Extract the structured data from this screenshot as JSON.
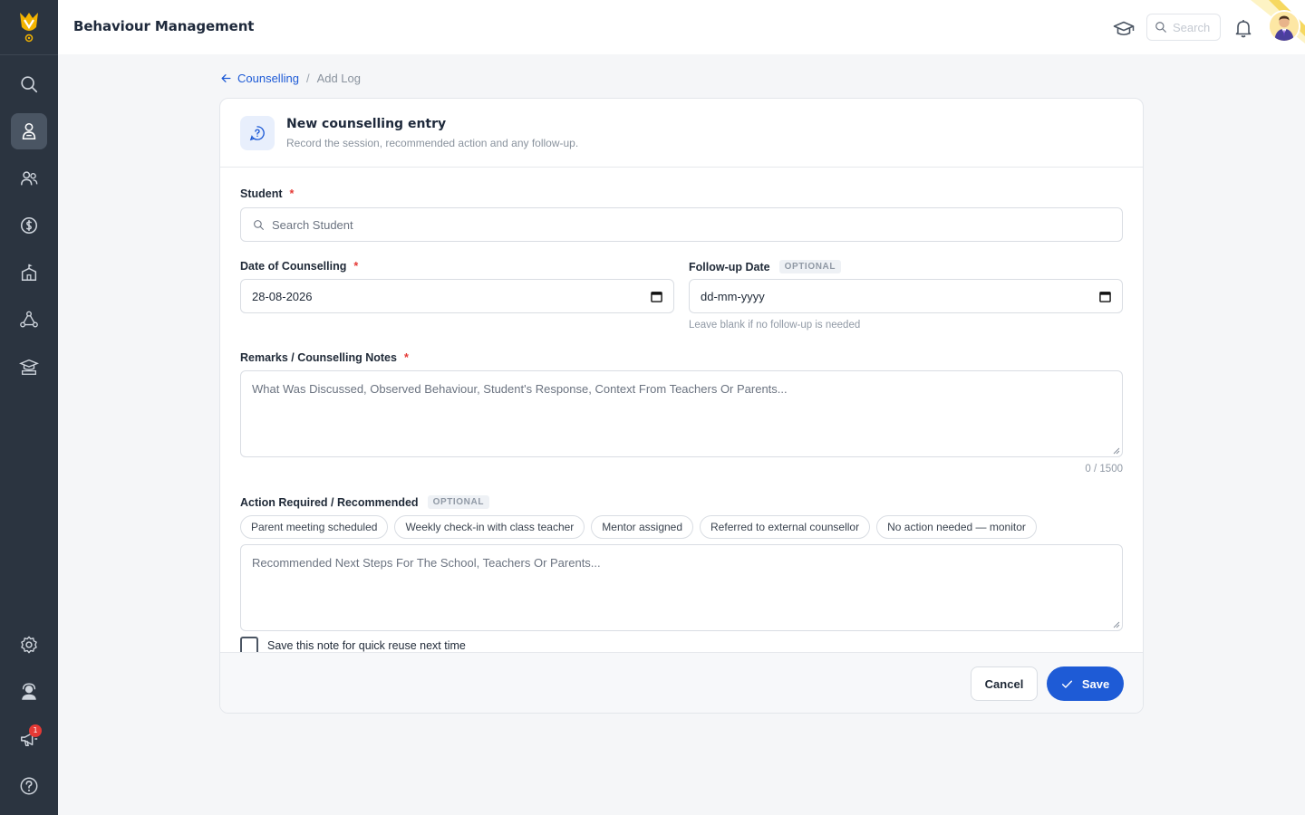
{
  "app": {
    "title": "Behaviour Management",
    "search_placeholder": "Search",
    "notification_count": "1"
  },
  "sidebar": {
    "items": [
      {
        "icon": "search-icon"
      },
      {
        "icon": "student-icon",
        "active": true
      },
      {
        "icon": "users-icon"
      },
      {
        "icon": "dollar-icon"
      },
      {
        "icon": "school-building-icon"
      },
      {
        "icon": "network-icon"
      },
      {
        "icon": "classroom-icon"
      },
      {
        "icon": "gear-icon"
      },
      {
        "icon": "support-agent-icon"
      },
      {
        "icon": "megaphone-icon"
      },
      {
        "icon": "help-icon"
      }
    ]
  },
  "breadcrumb": {
    "parent": "Counselling",
    "separator": "/",
    "current": "Add Log"
  },
  "form": {
    "title": "New counselling entry",
    "subtitle": "Record the session, recommended action and any follow-up.",
    "student_label": "Student",
    "student_placeholder": "Search Student",
    "date_label": "Date of Counselling",
    "date_value": "28-08-2026",
    "followup_label": "Follow-up Date",
    "optional_tag": "OPTIONAL",
    "followup_placeholder": "dd-mm-yyyy",
    "followup_hint": "Leave blank if no follow-up is needed",
    "remarks_label": "Remarks / Counselling Notes",
    "remarks_placeholder": "What Was Discussed, Observed Behaviour, Student's Response, Context From Teachers Or Parents...",
    "remarks_counter": "0 / 1500",
    "action_label": "Action Required / Recommended",
    "action_chips": [
      "Parent meeting scheduled",
      "Weekly check-in with class teacher",
      "Mentor assigned",
      "Referred to external counsellor",
      "No action needed — monitor"
    ],
    "action_placeholder": "Recommended Next Steps For The School, Teachers Or Parents...",
    "save_note_label": "Save this note for quick reuse next time",
    "required_mark": "*"
  },
  "footer": {
    "cancel_label": "Cancel",
    "save_label": "Save"
  },
  "colors": {
    "sidebar_bg": "#2b3440",
    "accent": "#1e5bd6",
    "required": "#e53935"
  }
}
